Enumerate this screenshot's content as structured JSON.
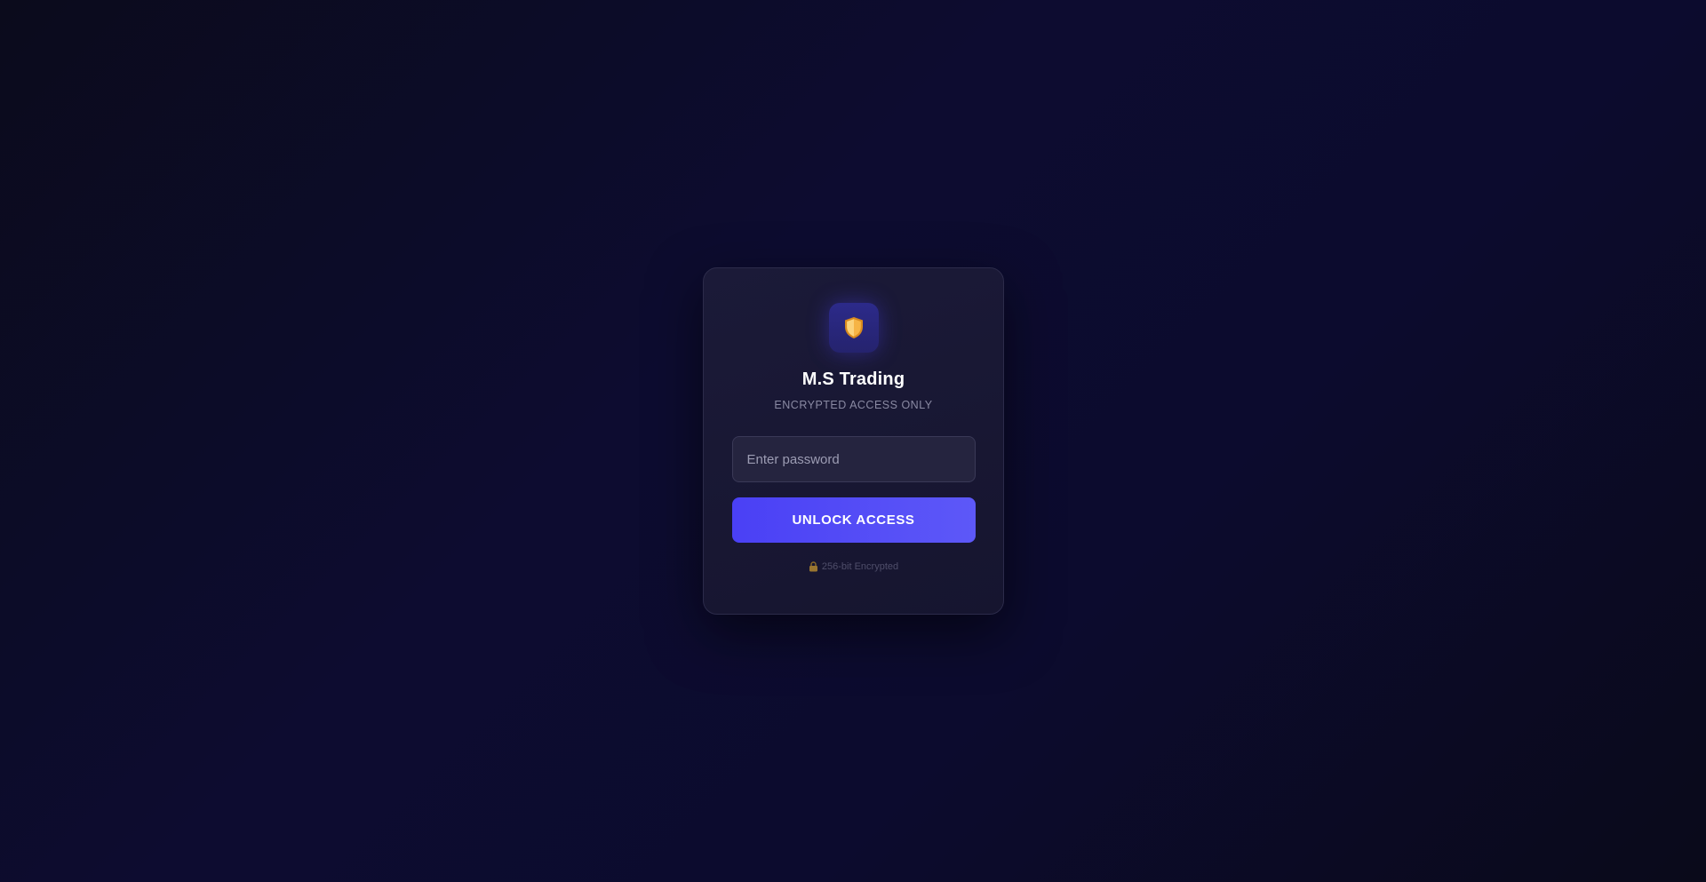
{
  "brand": {
    "icon": "shield-icon",
    "title": "M.S Trading",
    "subtitle": "ENCRYPTED ACCESS ONLY"
  },
  "form": {
    "password_placeholder": "Enter password",
    "password_value": "",
    "submit_label": "UNLOCK ACCESS"
  },
  "footer": {
    "icon": "lock-icon",
    "text": "256-bit Encrypted"
  },
  "colors": {
    "accent": "#4a40f5",
    "shield": "#f0a030",
    "background": "#0d0c30"
  }
}
